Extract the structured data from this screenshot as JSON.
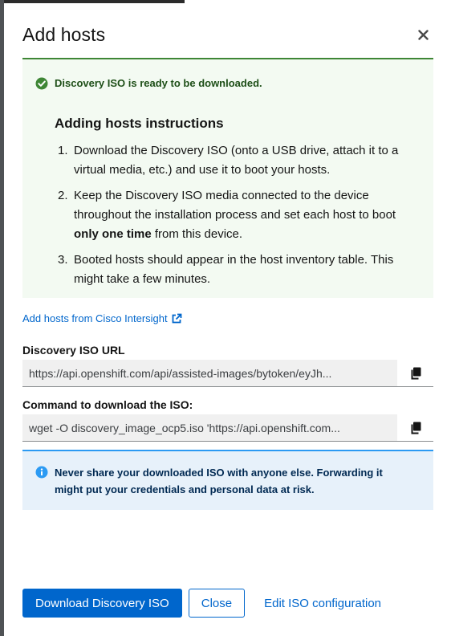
{
  "modal": {
    "title": "Add hosts",
    "close_icon": "close-icon"
  },
  "success_alert": {
    "icon": "check-circle-icon",
    "title": "Discovery ISO is ready to be downloaded.",
    "heading": "Adding hosts instructions",
    "steps": [
      {
        "num": "1.",
        "text": "Download the Discovery ISO (onto a USB drive, attach it to a virtual media, etc.) and use it to boot your hosts."
      },
      {
        "num": "2.",
        "text_before": "Keep the Discovery ISO media connected to the device throughout the installation process and set each host to boot ",
        "text_bold": "only one time",
        "text_after": " from this device."
      },
      {
        "num": "3.",
        "text": "Booted hosts should appear in the host inventory table. This might take a few minutes."
      }
    ]
  },
  "cisco_link": {
    "label": "Add hosts from Cisco Intersight",
    "icon": "external-link-icon"
  },
  "iso_url": {
    "label": "Discovery ISO URL",
    "value": "https://api.openshift.com/api/assisted-images/bytoken/eyJh...",
    "copy_icon": "copy-icon"
  },
  "command": {
    "label": "Command to download the ISO:",
    "value": "wget -O discovery_image_ocp5.iso 'https://api.openshift.com...",
    "copy_icon": "copy-icon"
  },
  "info_alert": {
    "icon": "info-circle-icon",
    "text": "Never share your downloaded ISO with anyone else. Forwarding it might put your credentials and personal data at risk."
  },
  "footer": {
    "download_label": "Download Discovery ISO",
    "close_label": "Close",
    "edit_label": "Edit ISO configuration"
  },
  "colors": {
    "primary": "#0066cc",
    "success": "#3e8635",
    "info": "#2b9af3"
  }
}
